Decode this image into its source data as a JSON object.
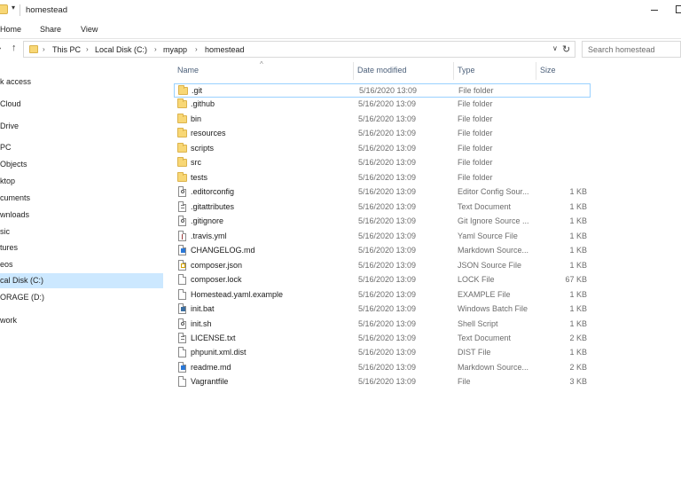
{
  "window": {
    "title": "homestead"
  },
  "ribbon": {
    "tabs": [
      "Home",
      "Share",
      "View"
    ]
  },
  "address": {
    "segments": [
      "This PC",
      "Local Disk (C:)",
      "myapp",
      "homestead"
    ]
  },
  "search": {
    "placeholder": "Search homestead"
  },
  "nav_pane": {
    "items": [
      {
        "label": "k access",
        "selected": false
      },
      {
        "label": "Cloud",
        "selected": false
      },
      {
        "label": "Drive",
        "selected": false
      },
      {
        "label": "PC",
        "selected": false
      },
      {
        "label": "Objects",
        "selected": false
      },
      {
        "label": "ktop",
        "selected": false
      },
      {
        "label": "cuments",
        "selected": false
      },
      {
        "label": "wnloads",
        "selected": false
      },
      {
        "label": "sic",
        "selected": false
      },
      {
        "label": "tures",
        "selected": false
      },
      {
        "label": "eos",
        "selected": false
      },
      {
        "label": "cal Disk (C:)",
        "selected": true
      },
      {
        "label": "ORAGE (D:)",
        "selected": false
      },
      {
        "label": "work",
        "selected": false
      }
    ]
  },
  "columns": {
    "name": "Name",
    "date": "Date modified",
    "type": "Type",
    "size": "Size"
  },
  "files": [
    {
      "name": ".git",
      "date": "5/16/2020 13:09",
      "type": "File folder",
      "size": "",
      "icon": "folder-icon"
    },
    {
      "name": ".github",
      "date": "5/16/2020 13:09",
      "type": "File folder",
      "size": "",
      "icon": "folder-icon"
    },
    {
      "name": "bin",
      "date": "5/16/2020 13:09",
      "type": "File folder",
      "size": "",
      "icon": "folder-icon"
    },
    {
      "name": "resources",
      "date": "5/16/2020 13:09",
      "type": "File folder",
      "size": "",
      "icon": "folder-icon"
    },
    {
      "name": "scripts",
      "date": "5/16/2020 13:09",
      "type": "File folder",
      "size": "",
      "icon": "folder-icon"
    },
    {
      "name": "src",
      "date": "5/16/2020 13:09",
      "type": "File folder",
      "size": "",
      "icon": "folder-icon"
    },
    {
      "name": "tests",
      "date": "5/16/2020 13:09",
      "type": "File folder",
      "size": "",
      "icon": "folder-icon"
    },
    {
      "name": ".editorconfig",
      "date": "5/16/2020 13:09",
      "type": "Editor Config Sour...",
      "size": "1 KB",
      "icon": "config-file-icon"
    },
    {
      "name": ".gitattributes",
      "date": "5/16/2020 13:09",
      "type": "Text Document",
      "size": "1 KB",
      "icon": "text-file-icon"
    },
    {
      "name": ".gitignore",
      "date": "5/16/2020 13:09",
      "type": "Git Ignore Source ...",
      "size": "1 KB",
      "icon": "config-file-icon"
    },
    {
      "name": ".travis.yml",
      "date": "5/16/2020 13:09",
      "type": "Yaml Source File",
      "size": "1 KB",
      "icon": "yaml-file-icon"
    },
    {
      "name": "CHANGELOG.md",
      "date": "5/16/2020 13:09",
      "type": "Markdown Source...",
      "size": "1 KB",
      "icon": "markdown-file-icon"
    },
    {
      "name": "composer.json",
      "date": "5/16/2020 13:09",
      "type": "JSON Source File",
      "size": "1 KB",
      "icon": "json-file-icon"
    },
    {
      "name": "composer.lock",
      "date": "5/16/2020 13:09",
      "type": "LOCK File",
      "size": "67 KB",
      "icon": "file-icon"
    },
    {
      "name": "Homestead.yaml.example",
      "date": "5/16/2020 13:09",
      "type": "EXAMPLE File",
      "size": "1 KB",
      "icon": "file-icon"
    },
    {
      "name": "init.bat",
      "date": "5/16/2020 13:09",
      "type": "Windows Batch File",
      "size": "1 KB",
      "icon": "batch-file-icon"
    },
    {
      "name": "init.sh",
      "date": "5/16/2020 13:09",
      "type": "Shell Script",
      "size": "1 KB",
      "icon": "config-file-icon"
    },
    {
      "name": "LICENSE.txt",
      "date": "5/16/2020 13:09",
      "type": "Text Document",
      "size": "2 KB",
      "icon": "text-file-icon"
    },
    {
      "name": "phpunit.xml.dist",
      "date": "5/16/2020 13:09",
      "type": "DIST File",
      "size": "1 KB",
      "icon": "file-icon"
    },
    {
      "name": "readme.md",
      "date": "5/16/2020 13:09",
      "type": "Markdown Source...",
      "size": "2 KB",
      "icon": "markdown-file-icon"
    },
    {
      "name": "Vagrantfile",
      "date": "5/16/2020 13:09",
      "type": "File",
      "size": "3 KB",
      "icon": "file-icon"
    }
  ],
  "colors": {
    "selection": "#cce8ff",
    "folder": "#f8d775",
    "header_text": "#4c607a",
    "focus_border": "#99d1ff"
  }
}
